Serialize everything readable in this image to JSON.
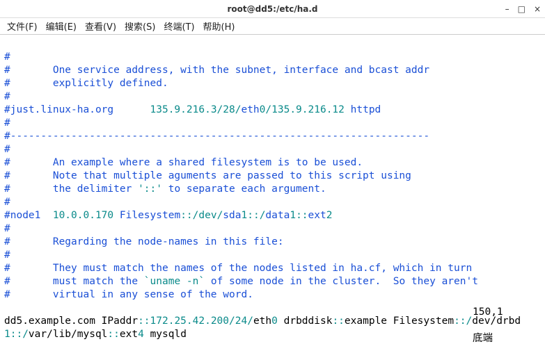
{
  "window": {
    "title": "root@dd5:/etc/ha.d",
    "controls": {
      "minimize": "–",
      "maximize": "□",
      "close": "×"
    }
  },
  "menu": {
    "file": "文件(F)",
    "edit": "编辑(E)",
    "view": "查看(V)",
    "search": "搜索(S)",
    "term": "终端(T)",
    "help": "帮助(H)"
  },
  "lines": {
    "l1": "#",
    "l2a": "#       One service address, with the subnet, interface and bcast addr",
    "l3": "#       explicitly defined.",
    "l4": "#",
    "l5a": "#just.linux-ha.org      ",
    "l5b": "135.9.216.3/28/",
    "l5c": "eth",
    "l5d": "0/135.9.216.12 ",
    "l5e": "httpd",
    "l6": "#",
    "l7": "#---------------------------------------------------------------------",
    "l8": "#",
    "l9": "#       An example where a shared filesystem is to be used.",
    "l10": "#       Note that multiple aguments are passed to this script using",
    "l11a": "#       the delimiter ",
    "l11b": "'::'",
    "l11c": " to separate each argument.",
    "l12": "#",
    "l13a": "#node1  ",
    "l13b": "10.0.0.170 ",
    "l13c": "Filesystem",
    "l13d": "::/dev/",
    "l13e": "sda",
    "l13f": "1::/",
    "l13g": "data",
    "l13h": "1::",
    "l13i": "ext",
    "l13j": "2",
    "l14": "#",
    "l15": "#       Regarding the node-names in this file:",
    "l16": "#",
    "l17": "#       They must match the names of the nodes listed in ha.cf, which in turn",
    "l18a": "#       must match the ",
    "l18b": "`uname -n`",
    "l18c": " of some node in the cluster.  So they aren't",
    "l19": "#       virtual in any sense of the word.",
    "lblank": " ",
    "cfg_a": "dd5.example.com IPaddr",
    "cfg_b": "::172.25.42.200/24/",
    "cfg_c": "eth",
    "cfg_d": "0 ",
    "cfg_e": "drbddisk",
    "cfg_f": "::",
    "cfg_g": "example Filesystem",
    "cfg_h": "::/",
    "cfg_i": "de",
    "cfg_j": "v/drbd",
    "cfg_k": "1::/",
    "cfg_l": "var/lib/mysql",
    "cfg_m": "::",
    "cfg_n": "ext",
    "cfg_o": "4 ",
    "cfg_p": "mysqld"
  },
  "status": {
    "position": "150,1",
    "mode": "底端"
  }
}
